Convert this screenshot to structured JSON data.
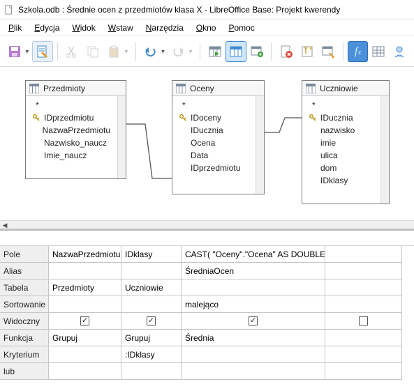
{
  "window": {
    "title": "Szkola.odb : Średnie ocen z przedmiotów klasa X - LibreOffice Base: Projekt kwerendy"
  },
  "menu": {
    "items": [
      "Plik",
      "Edycja",
      "Widok",
      "Wstaw",
      "Narzędzia",
      "Okno",
      "Pomoc"
    ]
  },
  "toolbar": {
    "icons": {
      "save": "save-icon",
      "edit": "edit-file-icon",
      "cut": "cut-icon",
      "copy": "copy-icon",
      "paste": "paste-icon",
      "undo": "undo-icon",
      "redo": "redo-icon",
      "run": "run-query-icon",
      "design1": "design-view-icon",
      "design2": "design-view-selected-icon",
      "design3": "add-table-icon",
      "delete": "delete-icon",
      "newtab": "new-query-icon",
      "props": "properties-icon",
      "fx": "functions-icon",
      "grid": "table-grid-icon",
      "unique": "distinct-icon"
    }
  },
  "tables": {
    "t1": {
      "name": "Przedmioty",
      "star": "*",
      "fields": [
        {
          "name": "IDprzedmiotu",
          "pk": true
        },
        {
          "name": "NazwaPrzedmiotu",
          "pk": false
        },
        {
          "name": "Nazwisko_naucz",
          "pk": false
        },
        {
          "name": "Imie_naucz",
          "pk": false
        }
      ]
    },
    "t2": {
      "name": "Oceny",
      "star": "*",
      "fields": [
        {
          "name": "IDoceny",
          "pk": true
        },
        {
          "name": "IDucznia",
          "pk": false
        },
        {
          "name": "Ocena",
          "pk": false
        },
        {
          "name": "Data",
          "pk": false
        },
        {
          "name": "IDprzedmiotu",
          "pk": false
        }
      ]
    },
    "t3": {
      "name": "Uczniowie",
      "star": "*",
      "fields": [
        {
          "name": "IDucznia",
          "pk": true
        },
        {
          "name": "nazwisko",
          "pk": false
        },
        {
          "name": "imie",
          "pk": false
        },
        {
          "name": "ulica",
          "pk": false
        },
        {
          "name": "dom",
          "pk": false
        },
        {
          "name": "IDklasy",
          "pk": false
        }
      ]
    }
  },
  "grid": {
    "row_labels": [
      "Pole",
      "Alias",
      "Tabela",
      "Sortowanie",
      "Widoczny",
      "Funkcja",
      "Kryterium",
      "lub"
    ],
    "columns": [
      {
        "pole": "NazwaPrzedmiotu",
        "alias": "",
        "tabela": "Przedmioty",
        "sortowanie": "",
        "widoczny": true,
        "funkcja": "Grupuj",
        "kryterium": "",
        "lub": ""
      },
      {
        "pole": "IDklasy",
        "alias": "",
        "tabela": "Uczniowie",
        "sortowanie": "",
        "widoczny": true,
        "funkcja": "Grupuj",
        "kryterium": ":IDklasy",
        "lub": ""
      },
      {
        "pole": "CAST( \"Oceny\".\"Ocena\" AS DOUBLE )",
        "alias": "ŚredniaOcen",
        "tabela": "",
        "sortowanie": "malejąco",
        "widoczny": true,
        "funkcja": "Średnia",
        "kryterium": "",
        "lub": ""
      },
      {
        "pole": "",
        "alias": "",
        "tabela": "",
        "sortowanie": "",
        "widoczny": false,
        "funkcja": "",
        "kryterium": "",
        "lub": ""
      }
    ]
  },
  "colors": {
    "accent": "#4b90d8"
  }
}
